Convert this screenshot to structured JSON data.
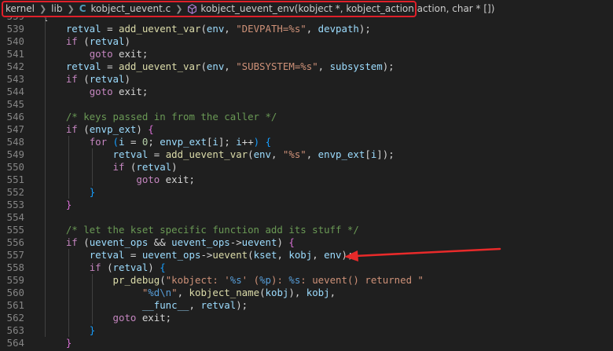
{
  "breadcrumb": {
    "items": [
      "kernel",
      "lib",
      "kobject_uevent.c",
      "kobject_uevent_env(kobject *, kobject_action action, char * [])"
    ],
    "c_badge": "C"
  },
  "lines": [
    {
      "n": "559",
      "toks": [
        [
          "op",
          "{"
        ]
      ]
    },
    {
      "n": "539",
      "toks": [
        [
          "op",
          "    "
        ],
        [
          "vr",
          "retval"
        ],
        [
          "op",
          " = "
        ],
        [
          "fn",
          "add_uevent_var"
        ],
        [
          "op",
          "("
        ],
        [
          "vr",
          "env"
        ],
        [
          "op",
          ", "
        ],
        [
          "st",
          "\"DEVPATH=%s\""
        ],
        [
          "op",
          ", "
        ],
        [
          "vr",
          "devpath"
        ],
        [
          "op",
          ");"
        ]
      ]
    },
    {
      "n": "540",
      "toks": [
        [
          "op",
          "    "
        ],
        [
          "kw",
          "if"
        ],
        [
          "op",
          " ("
        ],
        [
          "vr",
          "retval"
        ],
        [
          "op",
          ")"
        ]
      ]
    },
    {
      "n": "541",
      "toks": [
        [
          "op",
          "        "
        ],
        [
          "kw",
          "goto"
        ],
        [
          "op",
          " exit;"
        ]
      ]
    },
    {
      "n": "542",
      "toks": [
        [
          "op",
          "    "
        ],
        [
          "vr",
          "retval"
        ],
        [
          "op",
          " = "
        ],
        [
          "fn",
          "add_uevent_var"
        ],
        [
          "op",
          "("
        ],
        [
          "vr",
          "env"
        ],
        [
          "op",
          ", "
        ],
        [
          "st",
          "\"SUBSYSTEM=%s\""
        ],
        [
          "op",
          ", "
        ],
        [
          "vr",
          "subsystem"
        ],
        [
          "op",
          ");"
        ]
      ]
    },
    {
      "n": "543",
      "toks": [
        [
          "op",
          "    "
        ],
        [
          "kw",
          "if"
        ],
        [
          "op",
          " ("
        ],
        [
          "vr",
          "retval"
        ],
        [
          "op",
          ")"
        ]
      ]
    },
    {
      "n": "544",
      "toks": [
        [
          "op",
          "        "
        ],
        [
          "kw",
          "goto"
        ],
        [
          "op",
          " exit;"
        ]
      ]
    },
    {
      "n": "545",
      "toks": []
    },
    {
      "n": "546",
      "toks": [
        [
          "op",
          "    "
        ],
        [
          "cm",
          "/* keys passed in from the caller */"
        ]
      ]
    },
    {
      "n": "547",
      "toks": [
        [
          "op",
          "    "
        ],
        [
          "kw",
          "if"
        ],
        [
          "op",
          " ("
        ],
        [
          "vr",
          "envp_ext"
        ],
        [
          "op",
          ") "
        ],
        [
          "bk2",
          "{"
        ]
      ]
    },
    {
      "n": "548",
      "toks": [
        [
          "op",
          "        "
        ],
        [
          "kw",
          "for"
        ],
        [
          "op",
          " "
        ],
        [
          "bk3",
          "("
        ],
        [
          "vr",
          "i"
        ],
        [
          "op",
          " = "
        ],
        [
          "num",
          "0"
        ],
        [
          "op",
          "; "
        ],
        [
          "vr",
          "envp_ext"
        ],
        [
          "op",
          "["
        ],
        [
          "vr",
          "i"
        ],
        [
          "op",
          "]; "
        ],
        [
          "vr",
          "i"
        ],
        [
          "op",
          "++"
        ],
        [
          "bk3",
          ")"
        ],
        [
          "op",
          " "
        ],
        [
          "bk3",
          "{"
        ]
      ]
    },
    {
      "n": "549",
      "toks": [
        [
          "op",
          "            "
        ],
        [
          "vr",
          "retval"
        ],
        [
          "op",
          " = "
        ],
        [
          "fn",
          "add_uevent_var"
        ],
        [
          "op",
          "("
        ],
        [
          "vr",
          "env"
        ],
        [
          "op",
          ", "
        ],
        [
          "st",
          "\"%s\""
        ],
        [
          "op",
          ", "
        ],
        [
          "vr",
          "envp_ext"
        ],
        [
          "op",
          "["
        ],
        [
          "vr",
          "i"
        ],
        [
          "op",
          "]);"
        ]
      ]
    },
    {
      "n": "550",
      "toks": [
        [
          "op",
          "            "
        ],
        [
          "kw",
          "if"
        ],
        [
          "op",
          " ("
        ],
        [
          "vr",
          "retval"
        ],
        [
          "op",
          ")"
        ]
      ]
    },
    {
      "n": "551",
      "toks": [
        [
          "op",
          "                "
        ],
        [
          "kw",
          "goto"
        ],
        [
          "op",
          " exit;"
        ]
      ]
    },
    {
      "n": "552",
      "toks": [
        [
          "op",
          "        "
        ],
        [
          "bk3",
          "}"
        ]
      ]
    },
    {
      "n": "553",
      "toks": [
        [
          "op",
          "    "
        ],
        [
          "bk2",
          "}"
        ]
      ]
    },
    {
      "n": "554",
      "toks": []
    },
    {
      "n": "555",
      "toks": [
        [
          "op",
          "    "
        ],
        [
          "cm",
          "/* let the kset specific function add its stuff */"
        ]
      ]
    },
    {
      "n": "556",
      "toks": [
        [
          "op",
          "    "
        ],
        [
          "kw",
          "if"
        ],
        [
          "op",
          " ("
        ],
        [
          "vr",
          "uevent_ops"
        ],
        [
          "op",
          " && "
        ],
        [
          "vr",
          "uevent_ops"
        ],
        [
          "op",
          "->"
        ],
        [
          "vr",
          "uevent"
        ],
        [
          "op",
          ") "
        ],
        [
          "bk2",
          "{"
        ]
      ]
    },
    {
      "n": "557",
      "toks": [
        [
          "op",
          "        "
        ],
        [
          "vr",
          "retval"
        ],
        [
          "op",
          " = "
        ],
        [
          "vr",
          "uevent_ops"
        ],
        [
          "op",
          "->"
        ],
        [
          "fn",
          "uevent"
        ],
        [
          "op",
          "("
        ],
        [
          "vr",
          "kset"
        ],
        [
          "op",
          ", "
        ],
        [
          "vr",
          "kobj"
        ],
        [
          "op",
          ", "
        ],
        [
          "vr",
          "env"
        ],
        [
          "op",
          ");"
        ]
      ]
    },
    {
      "n": "558",
      "toks": [
        [
          "op",
          "        "
        ],
        [
          "kw",
          "if"
        ],
        [
          "op",
          " ("
        ],
        [
          "vr",
          "retval"
        ],
        [
          "op",
          ") "
        ],
        [
          "bk3",
          "{"
        ]
      ]
    },
    {
      "n": "559",
      "toks": [
        [
          "op",
          "            "
        ],
        [
          "fn",
          "pr_debug"
        ],
        [
          "op",
          "("
        ],
        [
          "st",
          "\"kobject: '"
        ],
        [
          "fmt",
          "%s"
        ],
        [
          "st",
          "' ("
        ],
        [
          "fmt",
          "%p"
        ],
        [
          "st",
          "): "
        ],
        [
          "fmt",
          "%s"
        ],
        [
          "st",
          ": uevent() returned \""
        ]
      ]
    },
    {
      "n": "560",
      "toks": [
        [
          "op",
          "                 "
        ],
        [
          "st",
          "\""
        ],
        [
          "fmt",
          "%d"
        ],
        [
          "fmt",
          "\\n"
        ],
        [
          "st",
          "\""
        ],
        [
          "op",
          ", "
        ],
        [
          "fn",
          "kobject_name"
        ],
        [
          "op",
          "("
        ],
        [
          "vr",
          "kobj"
        ],
        [
          "op",
          "), "
        ],
        [
          "vr",
          "kobj"
        ],
        [
          "op",
          ","
        ]
      ]
    },
    {
      "n": "561",
      "toks": [
        [
          "op",
          "                 "
        ],
        [
          "vr",
          "__func__"
        ],
        [
          "op",
          ", "
        ],
        [
          "vr",
          "retval"
        ],
        [
          "op",
          ");"
        ]
      ]
    },
    {
      "n": "562",
      "toks": [
        [
          "op",
          "            "
        ],
        [
          "kw",
          "goto"
        ],
        [
          "op",
          " exit;"
        ]
      ]
    },
    {
      "n": "563",
      "toks": [
        [
          "op",
          "        "
        ],
        [
          "bk3",
          "}"
        ]
      ]
    },
    {
      "n": "564",
      "toks": [
        [
          "op",
          "    "
        ],
        [
          "bk2",
          "}"
        ]
      ]
    }
  ]
}
